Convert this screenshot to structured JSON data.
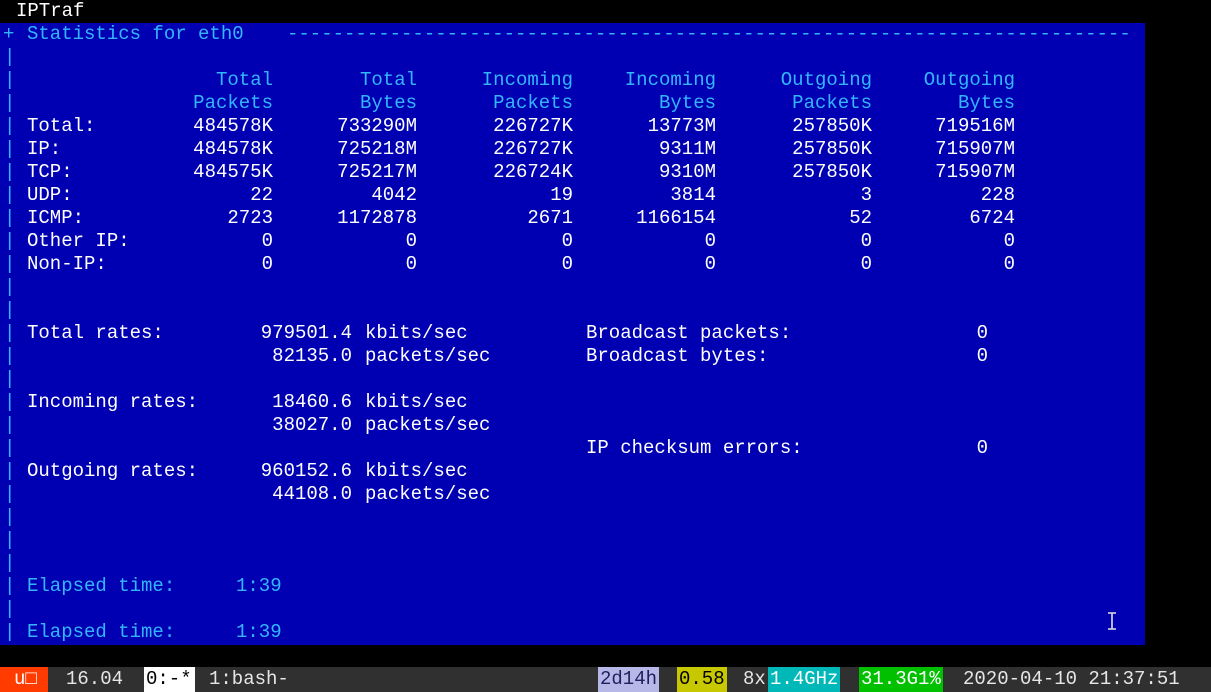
{
  "window": {
    "title": "IPTraf"
  },
  "header": {
    "corner": "+",
    "title": "Statistics for eth0"
  },
  "table": {
    "columns": [
      {
        "top": "Total",
        "bottom": "Packets"
      },
      {
        "top": "Total",
        "bottom": "Bytes"
      },
      {
        "top": "Incoming",
        "bottom": "Packets"
      },
      {
        "top": "Incoming",
        "bottom": "Bytes"
      },
      {
        "top": "Outgoing",
        "bottom": "Packets"
      },
      {
        "top": "Outgoing",
        "bottom": "Bytes"
      }
    ],
    "rows": [
      {
        "label": "Total:",
        "values": [
          "484578K",
          "733290M",
          "226727K",
          "13773M",
          "257850K",
          "719516M"
        ]
      },
      {
        "label": "IP:",
        "values": [
          "484578K",
          "725218M",
          "226727K",
          "9311M",
          "257850K",
          "715907M"
        ]
      },
      {
        "label": "TCP:",
        "values": [
          "484575K",
          "725217M",
          "226724K",
          "9310M",
          "257850K",
          "715907M"
        ]
      },
      {
        "label": "UDP:",
        "values": [
          "22",
          "4042",
          "19",
          "3814",
          "3",
          "228"
        ]
      },
      {
        "label": "ICMP:",
        "values": [
          "2723",
          "1172878",
          "2671",
          "1166154",
          "52",
          "6724"
        ]
      },
      {
        "label": "Other IP:",
        "values": [
          "0",
          "0",
          "0",
          "0",
          "0",
          "0"
        ]
      },
      {
        "label": "Non-IP:",
        "values": [
          "0",
          "0",
          "0",
          "0",
          "0",
          "0"
        ]
      }
    ]
  },
  "rates": {
    "total": {
      "label": "Total rates:",
      "kbits": "979501.4",
      "packets": "82135.0"
    },
    "incoming": {
      "label": "Incoming rates:",
      "kbits": "18460.6",
      "packets": "38027.0"
    },
    "outgoing": {
      "label": "Outgoing rates:",
      "kbits": "960152.6",
      "packets": "44108.0"
    },
    "kbits_unit": "kbits/sec",
    "packets_unit": "packets/sec"
  },
  "broadcast": {
    "packets_label": "Broadcast packets:",
    "packets_value": "0",
    "bytes_label": "Broadcast bytes:",
    "bytes_value": "0"
  },
  "checksum": {
    "label": "IP checksum errors:",
    "value": "0"
  },
  "elapsed": [
    {
      "label": "Elapsed time:",
      "value": "1:39"
    },
    {
      "label": "Elapsed time:",
      "value": "1:39"
    }
  ],
  "statusbar": {
    "session": "u□",
    "version": "16.04",
    "window_zero": "0:-*",
    "window_one": "1:bash-",
    "uptime": "2d14h",
    "load": "0.58",
    "cpu_count": "8x",
    "cpu_freq": "1.4GHz",
    "memory": "31.3G1%",
    "datetime": "2020-04-10 21:37:51"
  },
  "colors": {
    "terminal_bg": "#0000b2",
    "heading_text": "#33b6ff",
    "value_text": "#ffffff",
    "statusbar_bg": "#303030"
  },
  "icons": {
    "pointer": "ibeam-cursor-icon"
  }
}
